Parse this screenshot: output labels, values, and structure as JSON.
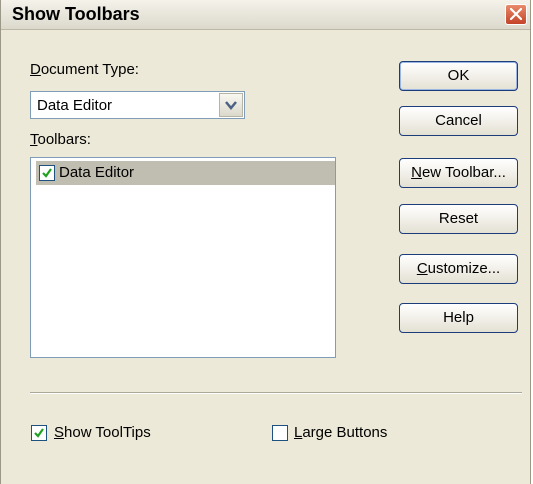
{
  "window": {
    "title": "Show Toolbars"
  },
  "document_type": {
    "label_accel": "D",
    "label_rest": "ocument Type:",
    "selected": "Data Editor"
  },
  "toolbars": {
    "label_accel": "T",
    "label_rest": "oolbars:",
    "items": [
      {
        "label": "Data Editor",
        "checked": true
      }
    ]
  },
  "buttons": {
    "ok": "OK",
    "cancel": "Cancel",
    "new_toolbar_accel": "N",
    "new_toolbar_rest": "ew Toolbar...",
    "reset": "Reset",
    "customize_accel": "C",
    "customize_rest": "ustomize...",
    "help": "Help"
  },
  "options": {
    "show_tooltips_accel": "S",
    "show_tooltips_rest": "how ToolTips",
    "show_tooltips_checked": true,
    "large_buttons_accel": "L",
    "large_buttons_rest": "arge Buttons",
    "large_buttons_checked": false
  },
  "icons": {
    "close": "close-icon",
    "dropdown": "chevron-down-icon",
    "check": "checkmark-icon"
  }
}
